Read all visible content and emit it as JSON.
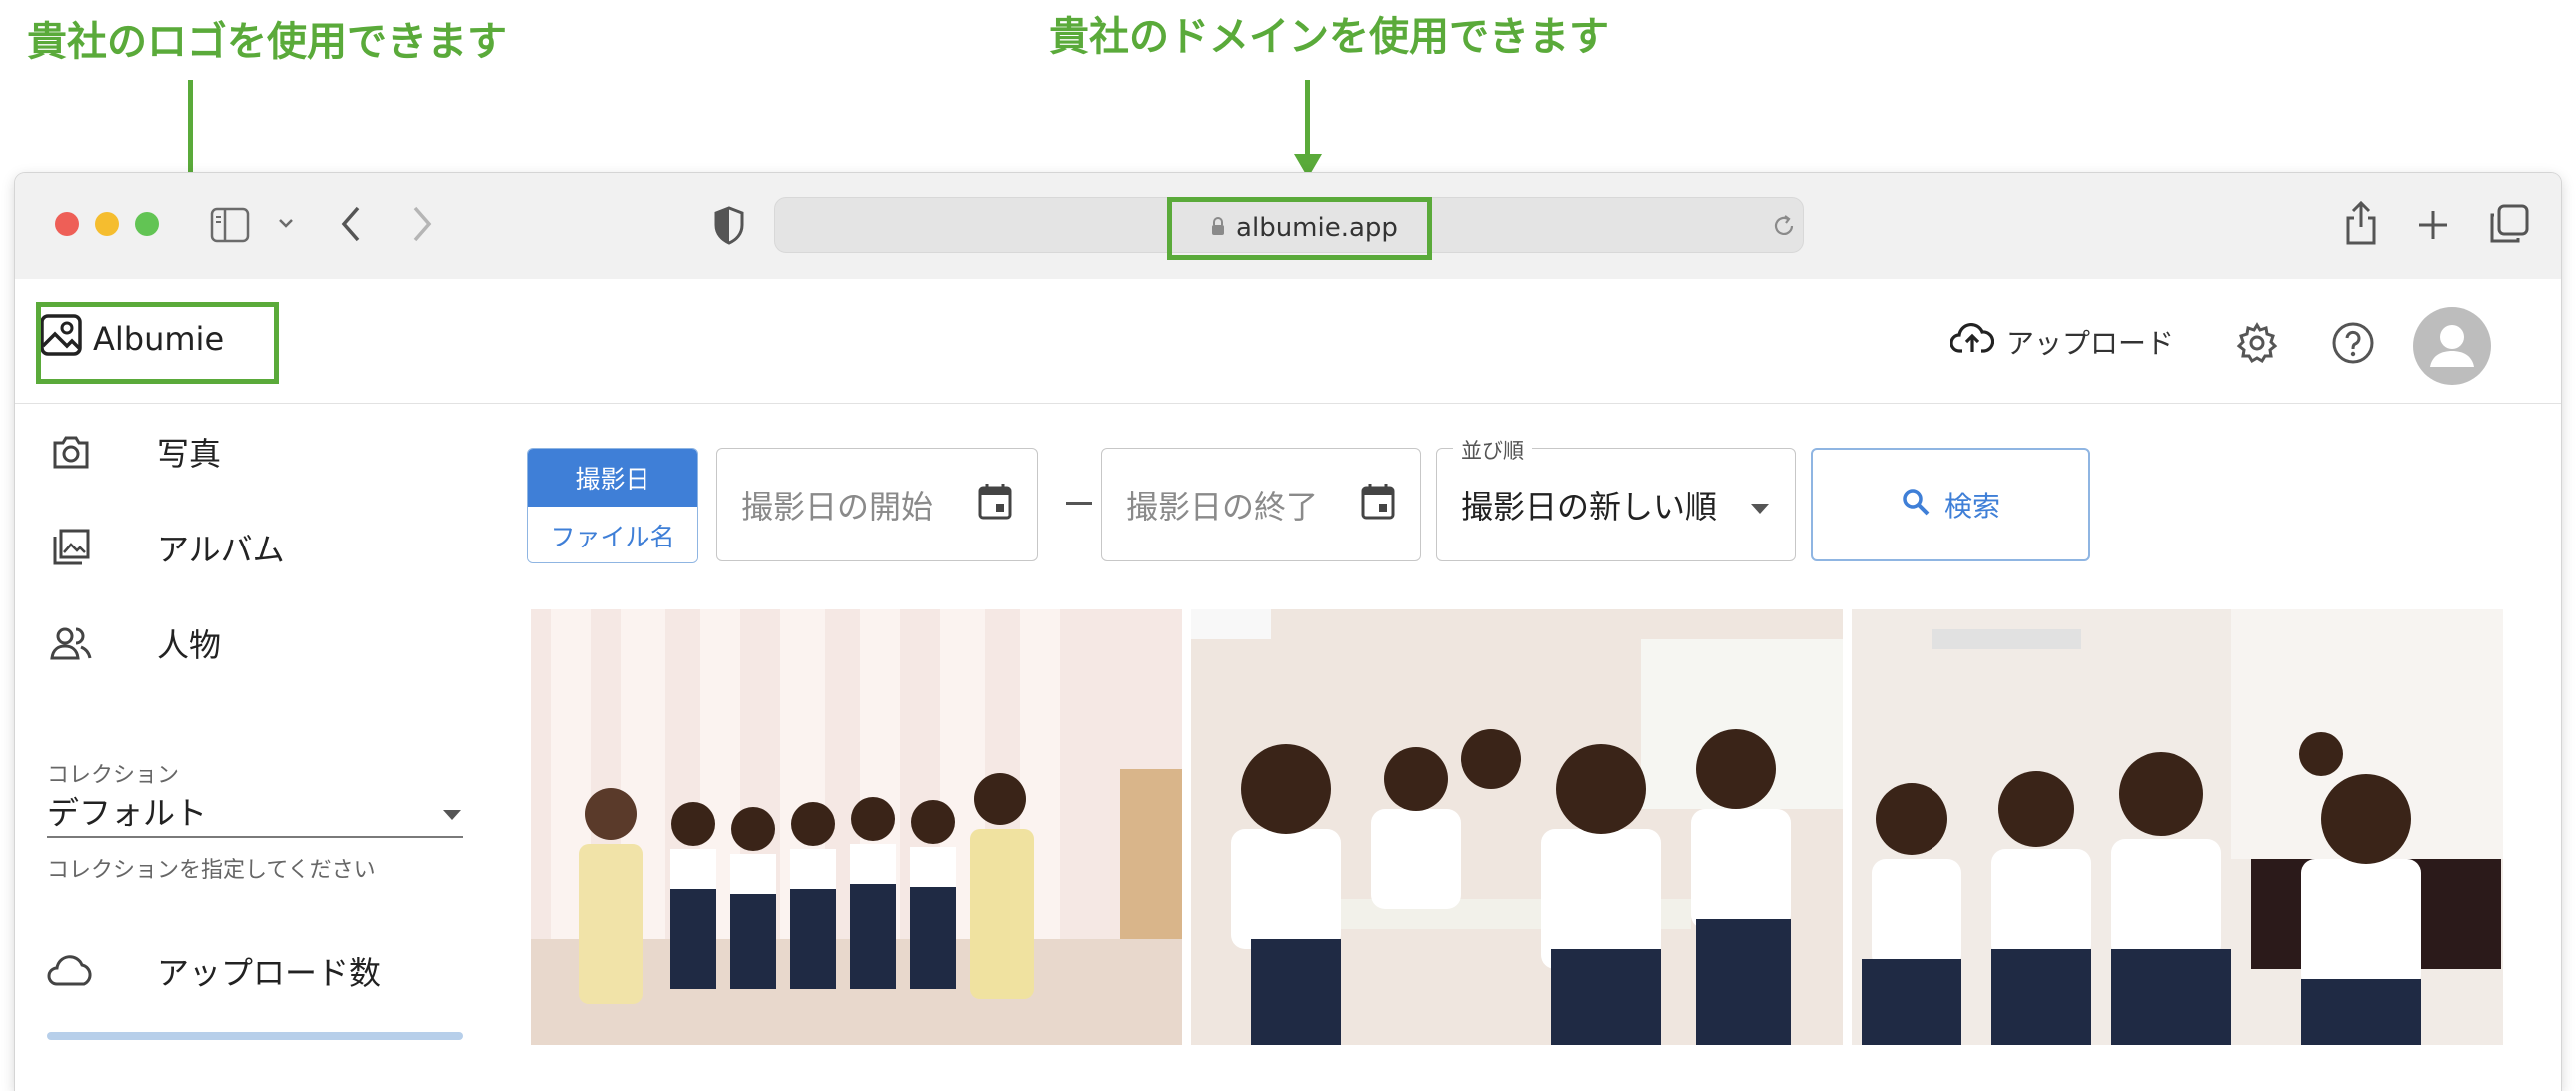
{
  "annotations": {
    "logo_caption": "貴社のロゴを使用できます",
    "domain_caption": "貴社のドメインを使用できます",
    "color": "#5aaa3a"
  },
  "browser": {
    "url": "albumie.app",
    "traffic_lights": [
      "#ee5f57",
      "#f5bd2f",
      "#62c454"
    ]
  },
  "header": {
    "brand": "Albumie",
    "upload_label": "アップロード"
  },
  "sidebar": {
    "items": [
      {
        "label": "写真",
        "icon": "camera-icon"
      },
      {
        "label": "アルバム",
        "icon": "album-icon"
      },
      {
        "label": "人物",
        "icon": "people-icon"
      }
    ],
    "collection": {
      "label": "コレクション",
      "value": "デフォルト",
      "help": "コレクションを指定してください"
    },
    "upload_count_label": "アップロード数"
  },
  "filters": {
    "mode_options": [
      "撮影日",
      "ファイル名"
    ],
    "mode_selected": "撮影日",
    "date_start_placeholder": "撮影日の開始",
    "date_end_placeholder": "撮影日の終了",
    "sort_label": "並び順",
    "sort_value": "撮影日の新しい順",
    "search_label": "検索"
  },
  "colors": {
    "accent": "#3f7fd7",
    "accent_light": "#8fb5e2"
  }
}
